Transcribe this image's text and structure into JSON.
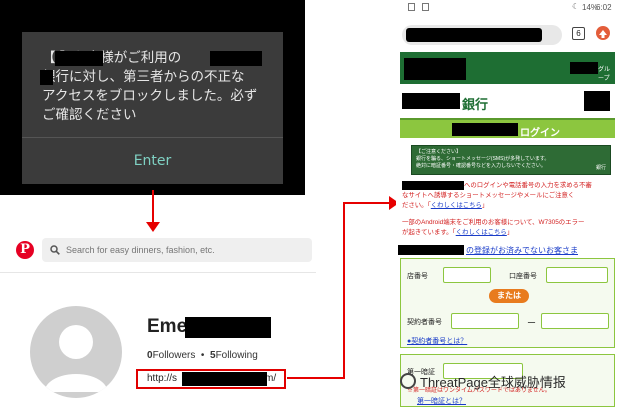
{
  "alert": {
    "line1": "【        】お客様がご利用の",
    "line2": "        銀行に対し、第三者からの不正な",
    "line3": "アクセスをブロックしました。必ず",
    "line4": "ご確認ください",
    "enter_label": "Enter"
  },
  "pinterest": {
    "logo_letter": "P",
    "search_placeholder": "Search for easy dinners, fashion, etc.",
    "profile_name": "Eme",
    "followers_count": "0",
    "followers_label": "Followers",
    "dot": "•",
    "following_count": "5",
    "following_label": "Following",
    "url_prefix": "http://s",
    "url_suffix": "m/"
  },
  "phone": {
    "status": {
      "battery": "14%",
      "time": "6:02"
    },
    "tab_count": "6",
    "group_label": "グループ",
    "bank_suffix": "銀行",
    "login_label": "ログイン",
    "notice_title": "【ご注意ください】",
    "notice_line1": "銀行を騙る、ショートメッセージ(SMS)が多発しています。",
    "notice_line2": "絶対に暗証番号・確認番号などを入力しないでください。",
    "notice_tag": "銀行",
    "warn1_line1": "へのログインや電話番号の入力を求める不審",
    "warn1_line2": "なサイトへ誘導するショートメッセージやメールにご注意く",
    "warn1_line3a": "ださい。「",
    "warn1_link": "くわしくはこちら",
    "warn1_line3b": "」",
    "warn2_line1": "一部のAndroid端末をご利用のお客様について、W7305のエラー",
    "warn2_line2a": "が起きています。「",
    "warn2_link": "くわしくはこちら",
    "warn2_line2b": "」",
    "unregistered": "の登録がお済みでないお客さま",
    "branch_label": "店番号",
    "account_label": "口座番号",
    "or_label": "または",
    "contract_label": "契約者番号",
    "dash": "ー",
    "contract_link": "●契約者番号とは？",
    "pin_label": "第一暗証",
    "pin_note": "※第一暗証はワンタイムパスワードではありません。",
    "pin_link": "第一暗証とは？"
  },
  "watermark": {
    "text": "ThreatPage全球威胁情报"
  },
  "colors": {
    "alert_bg": "#3b3b3b",
    "enter_teal": "#7fd1c3",
    "arrow_red": "#e60000",
    "pinterest_red": "#e60023",
    "bank_green": "#1e6e33",
    "login_green": "#8cc63f",
    "or_orange": "#e87b1e"
  },
  "icons": {
    "search": "search-icon",
    "pinterest_logo": "pinterest-logo-icon",
    "avatar": "person-avatar-icon",
    "battery": "battery-icon",
    "tabs": "tab-count-icon",
    "extension": "extension-icon"
  }
}
